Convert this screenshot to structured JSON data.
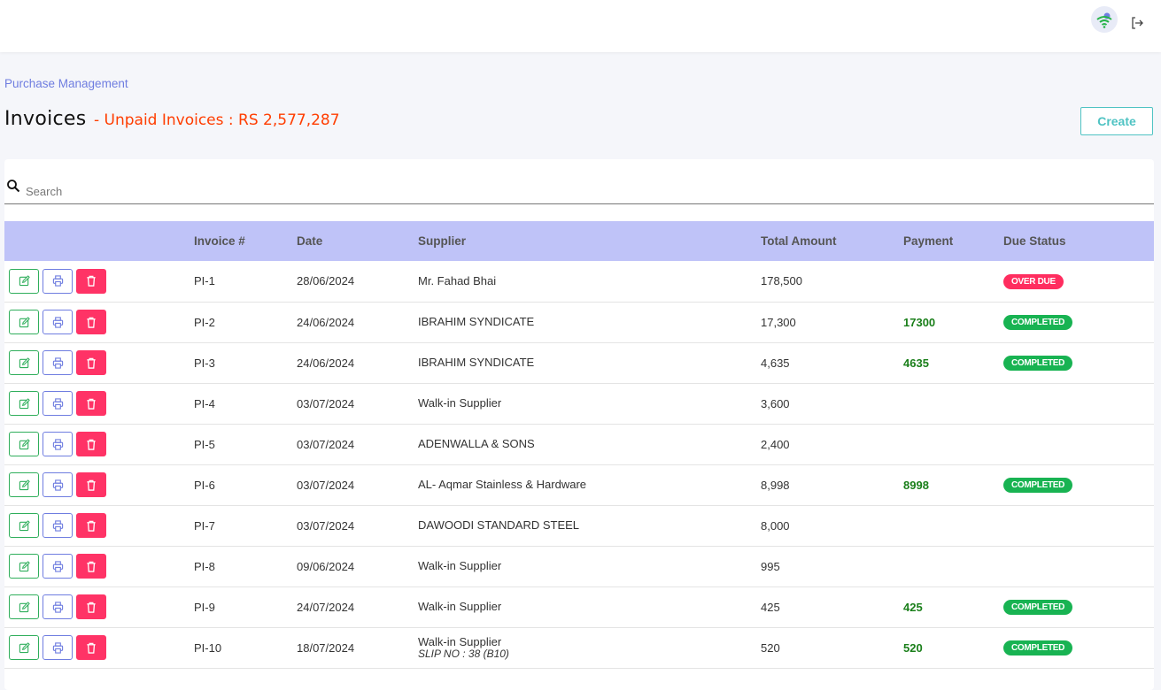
{
  "header": {
    "avatar_icon": "user-wifi-avatar-icon",
    "logout_icon": "logout-icon"
  },
  "breadcrumb": "Purchase Management",
  "page": {
    "title": "Invoices",
    "unpaid_label": "- Unpaid Invoices : RS 2,577,287",
    "create_label": "Create"
  },
  "search": {
    "placeholder": "Search",
    "value": ""
  },
  "table": {
    "columns": [
      "",
      "Invoice #",
      "Date",
      "Supplier",
      "Total Amount",
      "Payment",
      "Due Status"
    ],
    "rows": [
      {
        "invoice": "PI-1",
        "date": "28/06/2024",
        "supplier": "Mr. Fahad Bhai",
        "supplier_note": "",
        "total": "178,500",
        "payment": "",
        "status": "OVER DUE"
      },
      {
        "invoice": "PI-2",
        "date": "24/06/2024",
        "supplier": "IBRAHIM SYNDICATE",
        "supplier_note": "",
        "total": "17,300",
        "payment": "17300",
        "status": "COMPLETED"
      },
      {
        "invoice": "PI-3",
        "date": "24/06/2024",
        "supplier": "IBRAHIM SYNDICATE",
        "supplier_note": "",
        "total": "4,635",
        "payment": "4635",
        "status": "COMPLETED"
      },
      {
        "invoice": "PI-4",
        "date": "03/07/2024",
        "supplier": "Walk-in Supplier",
        "supplier_note": "",
        "total": "3,600",
        "payment": "",
        "status": ""
      },
      {
        "invoice": "PI-5",
        "date": "03/07/2024",
        "supplier": "ADENWALLA & SONS",
        "supplier_note": "",
        "total": "2,400",
        "payment": "",
        "status": ""
      },
      {
        "invoice": "PI-6",
        "date": "03/07/2024",
        "supplier": "AL- Aqmar Stainless & Hardware",
        "supplier_note": "",
        "total": "8,998",
        "payment": "8998",
        "status": "COMPLETED"
      },
      {
        "invoice": "PI-7",
        "date": "03/07/2024",
        "supplier": "DAWOODI STANDARD STEEL",
        "supplier_note": "",
        "total": "8,000",
        "payment": "",
        "status": ""
      },
      {
        "invoice": "PI-8",
        "date": "09/06/2024",
        "supplier": "Walk-in Supplier",
        "supplier_note": "",
        "total": "995",
        "payment": "",
        "status": ""
      },
      {
        "invoice": "PI-9",
        "date": "24/07/2024",
        "supplier": "Walk-in Supplier",
        "supplier_note": "",
        "total": "425",
        "payment": "425",
        "status": "COMPLETED"
      },
      {
        "invoice": "PI-10",
        "date": "18/07/2024",
        "supplier": "Walk-in Supplier",
        "supplier_note": "SLIP NO : 38 (B10)",
        "total": "520",
        "payment": "520",
        "status": "COMPLETED"
      }
    ]
  },
  "colors": {
    "header_row": "#bfc3f8",
    "accent": "#6f7de0",
    "create": "#4fc3c3",
    "unpaid": "#ff3d00",
    "completed": "#18b352",
    "overdue": "#ff2d5f",
    "payment": "#1a7f1a"
  },
  "icons": {
    "edit": "edit-icon",
    "print": "printer-icon",
    "delete": "trash-icon",
    "search": "search-icon"
  }
}
